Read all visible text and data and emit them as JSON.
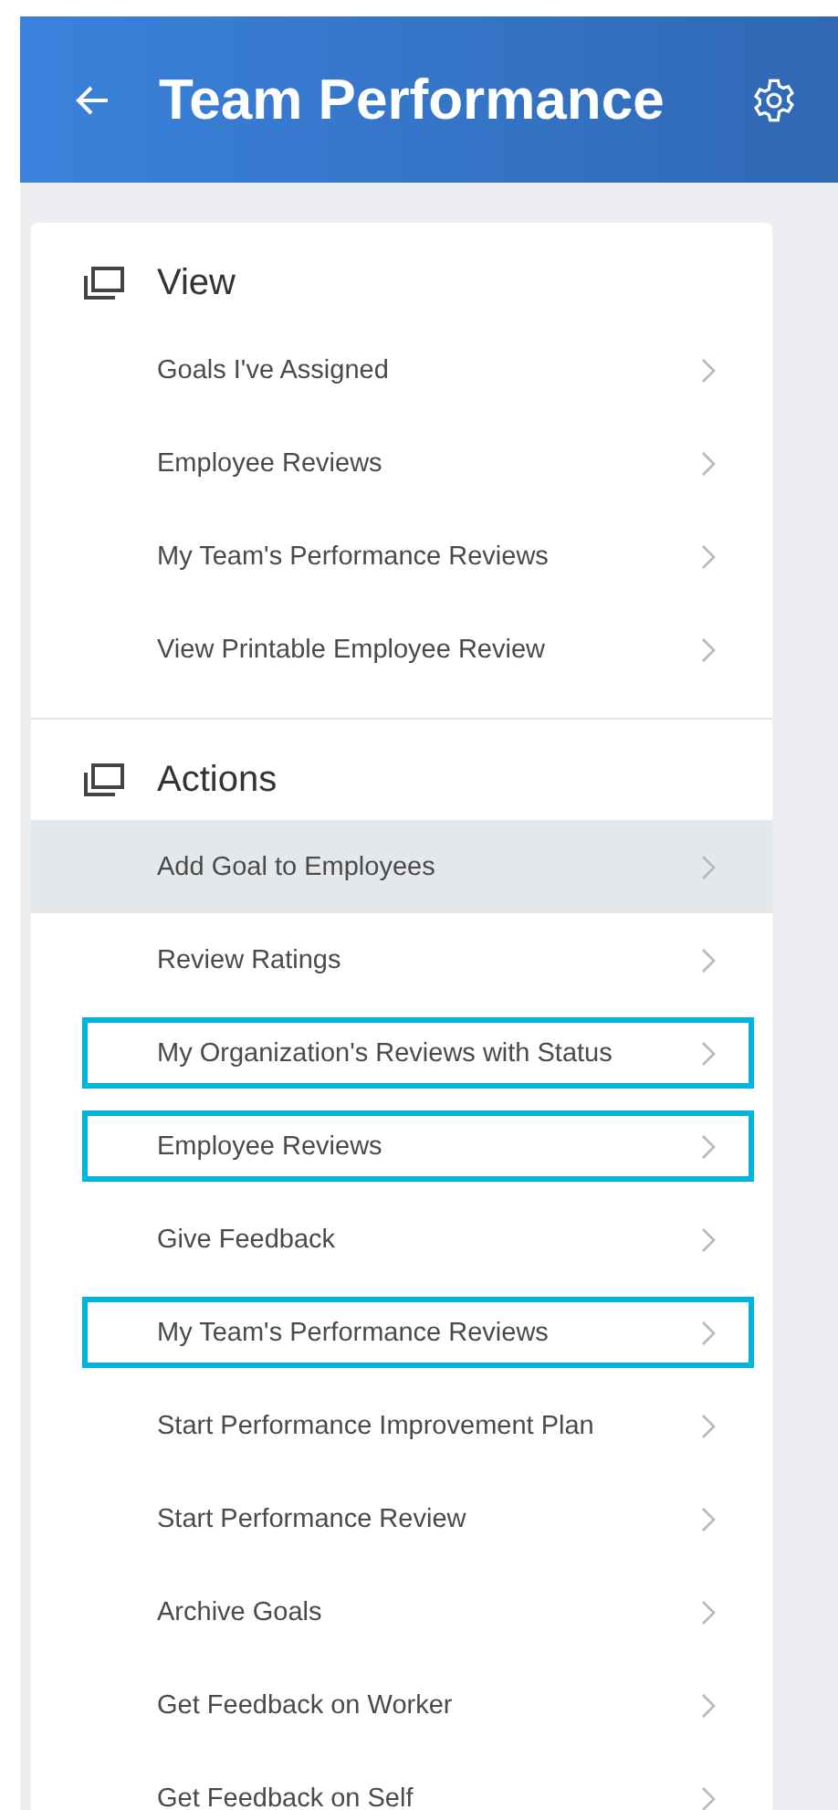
{
  "header": {
    "title": "Team Performance"
  },
  "sections": [
    {
      "title": "View",
      "items": [
        {
          "label": "Goals I've Assigned",
          "highlighted": false,
          "outlined": false
        },
        {
          "label": "Employee Reviews",
          "highlighted": false,
          "outlined": false
        },
        {
          "label": "My Team's Performance Reviews",
          "highlighted": false,
          "outlined": false
        },
        {
          "label": "View Printable Employee Review",
          "highlighted": false,
          "outlined": false
        }
      ]
    },
    {
      "title": "Actions",
      "items": [
        {
          "label": "Add Goal to Employees",
          "highlighted": true,
          "outlined": false
        },
        {
          "label": "Review Ratings",
          "highlighted": false,
          "outlined": false
        },
        {
          "label": "My Organization's Reviews with Status",
          "highlighted": false,
          "outlined": true
        },
        {
          "label": "Employee Reviews",
          "highlighted": false,
          "outlined": true
        },
        {
          "label": "Give Feedback",
          "highlighted": false,
          "outlined": false
        },
        {
          "label": "My Team's Performance Reviews",
          "highlighted": false,
          "outlined": true
        },
        {
          "label": "Start Performance Improvement Plan",
          "highlighted": false,
          "outlined": false
        },
        {
          "label": "Start Performance Review",
          "highlighted": false,
          "outlined": false
        },
        {
          "label": "Archive Goals",
          "highlighted": false,
          "outlined": false
        },
        {
          "label": "Get Feedback on Worker",
          "highlighted": false,
          "outlined": false
        },
        {
          "label": "Get Feedback on Self",
          "highlighted": false,
          "outlined": false
        }
      ]
    }
  ]
}
